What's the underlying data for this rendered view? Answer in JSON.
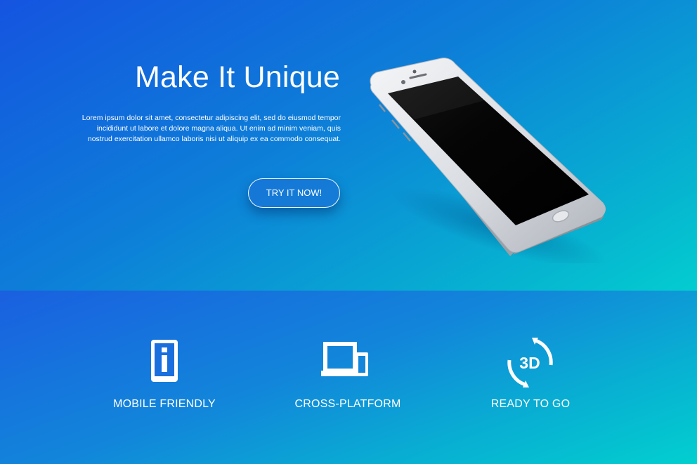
{
  "hero": {
    "title": "Make It Unique",
    "body": "Lorem ipsum dolor sit amet, consectetur adipiscing elit, sed do eiusmod tempor incididunt ut labore et dolore magna aliqua. Ut enim ad minim veniam, quis nostrud exercitation ullamco laboris nisi ut aliquip ex ea commodo consequat.",
    "cta_label": "TRY IT NOW!",
    "image": "smartphone-mockup"
  },
  "features": [
    {
      "icon": "mobile-info-icon",
      "label": "MOBILE FRIENDLY"
    },
    {
      "icon": "devices-icon",
      "label": "CROSS-PLATFORM"
    },
    {
      "icon": "rotate-3d-icon",
      "icon_text": "3D",
      "label": "READY TO GO"
    }
  ],
  "colors": {
    "hero_gradient": [
      "#1554e0",
      "#03cdd0"
    ],
    "features_gradient": [
      "#1a5fe0",
      "#02cfcf"
    ],
    "text": "#ffffff"
  }
}
